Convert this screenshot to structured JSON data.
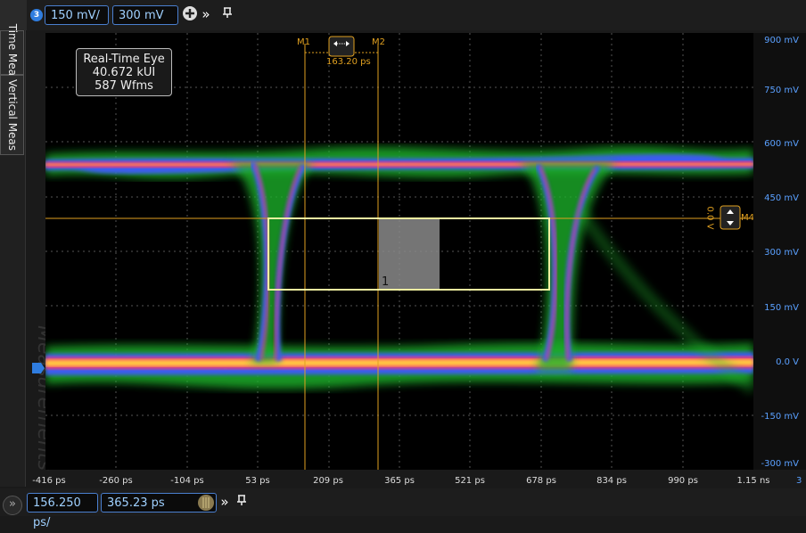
{
  "toolbar": {
    "channel_number": "3",
    "scale": "150 mV/",
    "offset": "300 mV",
    "add_icon": "plus-circle-icon",
    "more_icon": "double-chevron-icon",
    "pin_icon": "pin-icon"
  },
  "sidebar": {
    "tabs": [
      {
        "label": "Time Meas"
      },
      {
        "label": "Vertical Meas"
      }
    ],
    "watermark": "Measurements"
  },
  "info_box": {
    "line1": "Real-Time Eye",
    "line2": "40.672 kUI",
    "line3": "587 Wfms"
  },
  "markers": {
    "m1_label": "M1",
    "m2_label": "M2",
    "delta_label": "163.20 ps",
    "m4_label": "M4",
    "m4_level": "0.0 V",
    "mask_label": "1"
  },
  "y_axis": {
    "unit_color": "#5aa0ff",
    "ticks": [
      "900 mV",
      "750 mV",
      "600 mV",
      "450 mV",
      "300 mV",
      "150 mV",
      "0.0 V",
      "-150 mV",
      "-300 mV"
    ]
  },
  "x_axis": {
    "ticks": [
      "-416 ps",
      "-260 ps",
      "-104 ps",
      "53 ps",
      "209 ps",
      "365 ps",
      "521 ps",
      "678 ps",
      "834 ps",
      "990 ps",
      "1.15 ns"
    ],
    "channel_tag": "3"
  },
  "bottom_toolbar": {
    "timebase": "156.250 ps/",
    "position": "365.23 ps",
    "expand_icon": "double-chevron-icon",
    "knob_icon": "knob-icon",
    "more_icon": "double-chevron-icon",
    "pin_icon": "pin-icon"
  },
  "colors": {
    "accent": "#4a7fd0",
    "marker": "#e0a020",
    "mask": "#f0f0a0"
  }
}
